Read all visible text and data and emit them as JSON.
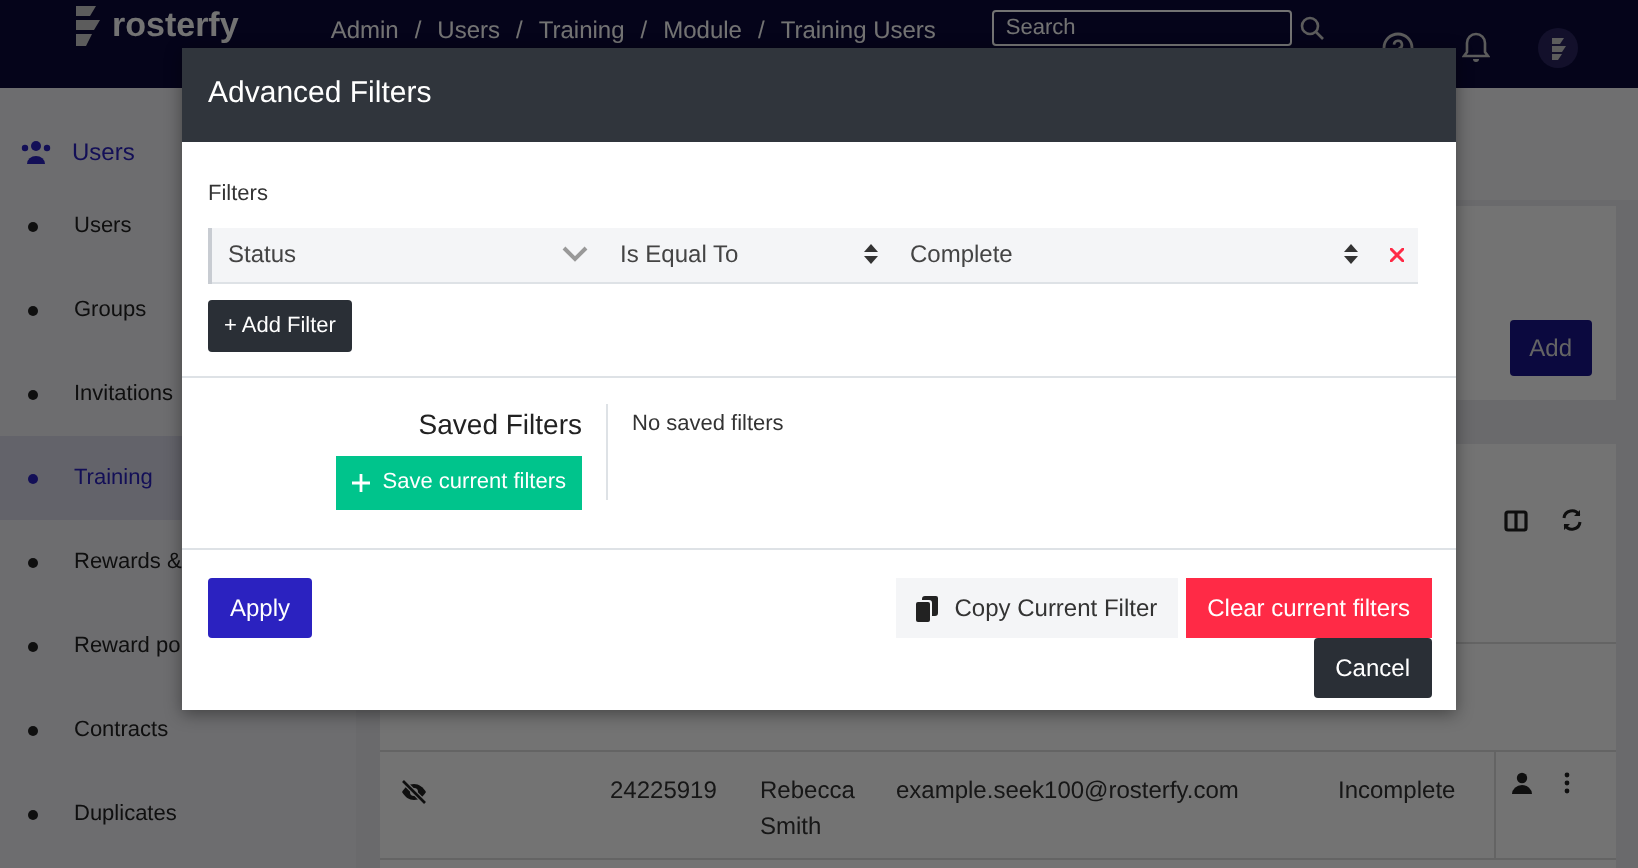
{
  "navbar": {
    "logo": "rosterfy",
    "breadcrumb": [
      "Admin",
      "Users",
      "Training",
      "Module",
      "Training Users"
    ],
    "breadcrumb_separator": "/",
    "search": {
      "placeholder": "Search"
    }
  },
  "sidebar": {
    "section": "Users",
    "items": [
      {
        "label": "Users",
        "selected": false
      },
      {
        "label": "Groups",
        "selected": false
      },
      {
        "label": "Invitations",
        "selected": false
      },
      {
        "label": "Training",
        "selected": true
      },
      {
        "label": "Rewards &",
        "selected": false
      },
      {
        "label": "Reward po",
        "selected": false
      },
      {
        "label": "Contracts",
        "selected": false
      },
      {
        "label": "Duplicates",
        "selected": false
      }
    ]
  },
  "main": {
    "add_button": "Add",
    "table": {
      "rows": [
        {
          "id": "24225919",
          "name": "Rebecca Smith",
          "email": "example.seek100@rosterfy.com",
          "status": "Incomplete",
          "hidden": true
        }
      ]
    }
  },
  "modal": {
    "title": "Advanced Filters",
    "filters_label": "Filters",
    "filters": [
      {
        "field": "Status",
        "operator": "Is Equal To",
        "value": "Complete"
      }
    ],
    "add_filter": "+ Add Filter",
    "saved_title": "Saved Filters",
    "save_button": "Save current filters",
    "saved_empty": "No saved filters",
    "apply": "Apply",
    "copy": "Copy Current Filter",
    "clear": "Clear current filters",
    "cancel": "Cancel"
  }
}
